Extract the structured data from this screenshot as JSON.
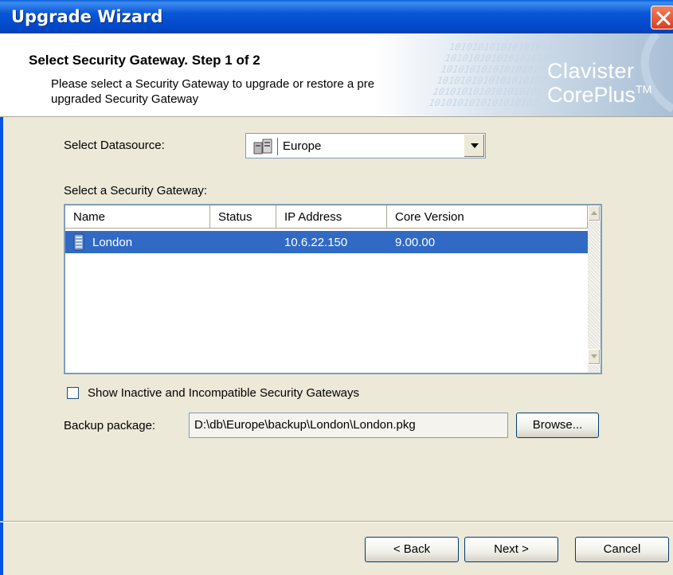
{
  "window": {
    "title": "Upgrade Wizard"
  },
  "header": {
    "step_title": "Select Security Gateway. Step 1 of 2",
    "description": "Please select a Security Gateway to upgrade or restore a previously upgraded Security Gateway",
    "logo_line1": "Clavister",
    "logo_line2": "CorePlus",
    "logo_tm": "TM",
    "logo_watermark": "1010101010101010101"
  },
  "datasource": {
    "label": "Select Datasource:",
    "value": "Europe",
    "icon": "database-icon"
  },
  "gateway_list": {
    "label": "Select a Security Gateway:",
    "columns": [
      "Name",
      "Status",
      "IP Address",
      "Core Version"
    ],
    "rows": [
      {
        "name": "London",
        "status": "",
        "ip": "10.6.22.150",
        "version": "9.00.00",
        "selected": true,
        "icon": "server-icon"
      }
    ]
  },
  "show_inactive": {
    "label": "Show Inactive and Incompatible Security Gateways",
    "checked": false
  },
  "backup": {
    "label": "Backup package:",
    "value": "D:\\db\\Europe\\backup\\London\\London.pkg",
    "browse_label": "Browse..."
  },
  "footer": {
    "back_label": "< Back",
    "next_label": "Next >",
    "cancel_label": "Cancel"
  },
  "colors": {
    "titlebar": "#0A5FD8",
    "selection": "#316AC5",
    "dialog_bg": "#ECE9D8",
    "logo_bg": "#B9CCE0"
  }
}
